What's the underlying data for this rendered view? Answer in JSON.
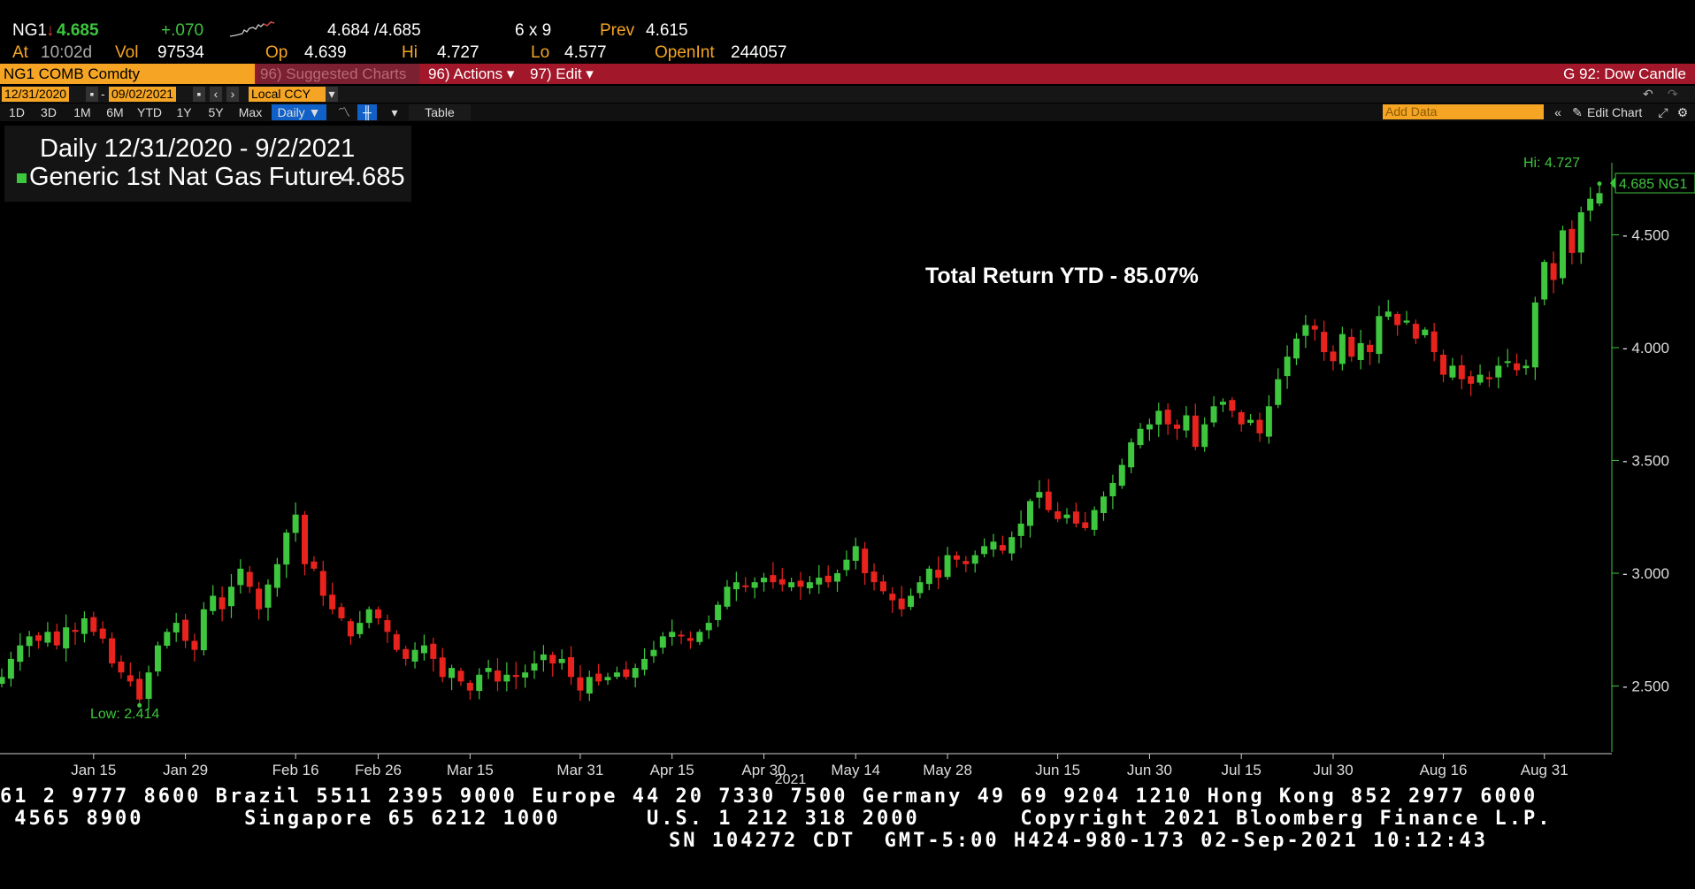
{
  "quote": {
    "ticker": "NG1",
    "arrow": "↓",
    "last": "4.685",
    "change": "+.070",
    "bid_ask": "4.684 /4.685",
    "size": "6 x 9",
    "prev_label": "Prev",
    "prev": "4.615",
    "at_label": "At",
    "time": "10:02d",
    "vol_label": "Vol",
    "vol": "97534",
    "op_label": "Op",
    "op": "4.639",
    "hi_label": "Hi",
    "hi": "4.727",
    "lo_label": "Lo",
    "lo": "4.577",
    "oi_label": "OpenInt",
    "oi": "244057"
  },
  "command_bar": {
    "security": "NG1 COMB Comdty",
    "suggested": "96) Suggested Charts",
    "actions": "96) Actions ▾",
    "edit": "97) Edit ▾",
    "function_name": "G 92: Dow Candle"
  },
  "date_bar": {
    "start": "12/31/2020",
    "sep": "-",
    "end": "09/02/2021",
    "currency": "Local CCY"
  },
  "range_bar": {
    "ranges": [
      "1D",
      "3D",
      "1M",
      "6M",
      "YTD",
      "1Y",
      "5Y",
      "Max"
    ],
    "period": "Daily ▼",
    "table": "Table",
    "add_data_placeholder": "Add Data",
    "edit_chart": "Edit Chart"
  },
  "legend": {
    "title": "Daily 12/31/2020 - 9/2/2021",
    "series": "Generic 1st Nat Gas Future",
    "value": "4.685"
  },
  "colors": {
    "up": "#3ec63e",
    "down": "#e8231e",
    "orange": "#f5a523",
    "barred": "#a3172a",
    "axis": "#3ec63e"
  },
  "chart_data": {
    "type": "candlestick",
    "annotation": "Total Return YTD - 85.07%",
    "hi_label": "Hi: 4.727",
    "low_label": "Low: 2.414",
    "last_label": "4.685 NG1",
    "ylim": [
      2.2,
      5.0
    ],
    "y_ticks": [
      "2.500",
      "3.000",
      "3.500",
      "4.000",
      "4.500"
    ],
    "x_ticks": [
      "Jan 15",
      "Jan 29",
      "Feb 16",
      "Feb 26",
      "Mar 15",
      "Mar 31",
      "Apr 15",
      "Apr 30",
      "May 14",
      "May 28",
      "Jun 15",
      "Jun 30",
      "Jul 15",
      "Jul 30",
      "Aug 16",
      "Aug 31"
    ],
    "x_tick_index": [
      10,
      20,
      32,
      41,
      51,
      63,
      73,
      83,
      93,
      103,
      115,
      125,
      135,
      145,
      157,
      168
    ],
    "year_label": "2021",
    "year_index": 83,
    "closes": [
      2.54,
      2.62,
      2.68,
      2.72,
      2.7,
      2.74,
      2.68,
      2.76,
      2.74,
      2.8,
      2.74,
      2.71,
      2.6,
      2.56,
      2.52,
      2.44,
      2.56,
      2.68,
      2.74,
      2.78,
      2.7,
      2.66,
      2.84,
      2.9,
      2.84,
      2.94,
      3.02,
      2.94,
      2.84,
      2.95,
      3.04,
      3.18,
      3.26,
      3.04,
      3.02,
      2.9,
      2.84,
      2.8,
      2.72,
      2.78,
      2.84,
      2.8,
      2.74,
      2.66,
      2.62,
      2.66,
      2.68,
      2.62,
      2.54,
      2.58,
      2.52,
      2.48,
      2.55,
      2.58,
      2.52,
      2.55,
      2.54,
      2.56,
      2.6,
      2.64,
      2.6,
      2.62,
      2.54,
      2.48,
      2.54,
      2.52,
      2.54,
      2.56,
      2.54,
      2.58,
      2.62,
      2.66,
      2.72,
      2.74,
      2.72,
      2.7,
      2.74,
      2.78,
      2.86,
      2.94,
      2.96,
      2.94,
      2.96,
      2.98,
      2.96,
      2.95,
      2.96,
      2.94,
      2.96,
      2.98,
      2.96,
      3.0,
      3.06,
      3.12,
      3.0,
      2.96,
      2.92,
      2.88,
      2.84,
      2.9,
      2.96,
      3.02,
      2.98,
      3.08,
      3.06,
      3.04,
      3.08,
      3.12,
      3.14,
      3.1,
      3.16,
      3.22,
      3.32,
      3.36,
      3.28,
      3.24,
      3.26,
      3.22,
      3.2,
      3.28,
      3.34,
      3.4,
      3.48,
      3.58,
      3.64,
      3.66,
      3.72,
      3.66,
      3.64,
      3.7,
      3.56,
      3.66,
      3.74,
      3.76,
      3.72,
      3.66,
      3.68,
      3.62,
      3.74,
      3.86,
      3.96,
      4.04,
      4.1,
      4.08,
      3.98,
      3.94,
      4.06,
      3.96,
      4.02,
      3.98,
      4.14,
      4.16,
      4.1,
      4.12,
      4.04,
      4.08,
      3.98,
      3.88,
      3.92,
      3.86,
      3.84,
      3.88,
      3.86,
      3.92,
      3.94,
      3.9,
      3.92,
      4.2,
      4.38,
      4.3,
      4.52,
      4.42,
      4.6,
      4.66,
      4.685
    ]
  },
  "footer": {
    "line1": "61 2 9777 8600 Brazil 5511 2395 9000 Europe 44 20 7330 7500 Germany 49 69 9204 1210 Hong Kong 852 2977 6000",
    "line2": " 4565 8900       Singapore 65 6212 1000      U.S. 1 212 318 2000       Copyright 2021 Bloomberg Finance L.P.",
    "line3": "SN 104272 CDT  GMT-5:00 H424-980-173 02-Sep-2021 10:12:43"
  }
}
